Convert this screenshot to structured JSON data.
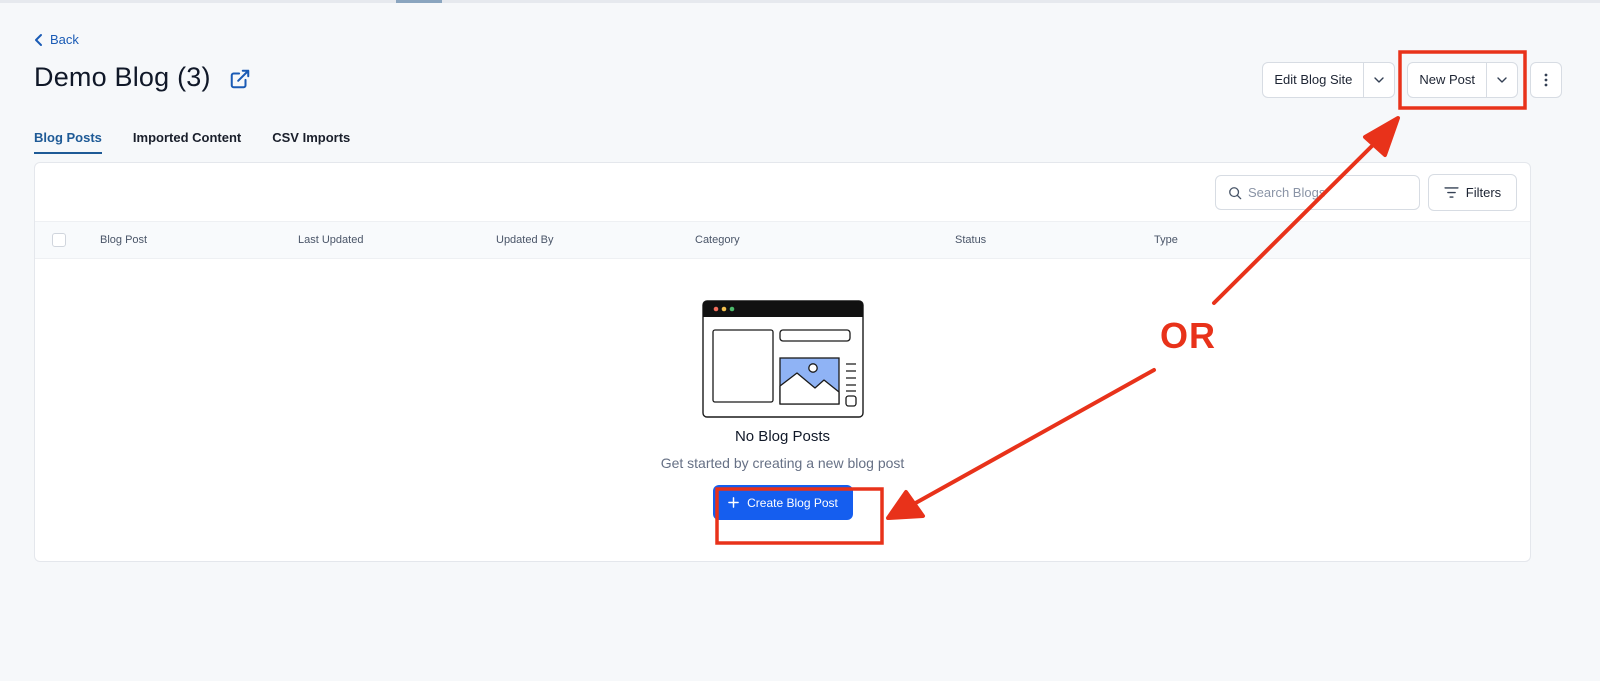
{
  "header": {
    "back_label": "Back",
    "title": "Demo Blog (3)"
  },
  "actions": {
    "edit_blog_site": "Edit Blog Site",
    "new_post": "New Post"
  },
  "tabs": [
    {
      "label": "Blog Posts",
      "active": true
    },
    {
      "label": "Imported Content",
      "active": false
    },
    {
      "label": "CSV Imports",
      "active": false
    }
  ],
  "toolbar": {
    "search_placeholder": "Search Blogs",
    "filters_label": "Filters"
  },
  "table": {
    "columns": [
      "Blog Post",
      "Last Updated",
      "Updated By",
      "Category",
      "Status",
      "Type"
    ]
  },
  "empty_state": {
    "title": "No Blog Posts",
    "subtitle": "Get started by creating a new blog post",
    "button_label": "Create Blog Post"
  },
  "annotation": {
    "label": "OR",
    "color": "#e8321a"
  },
  "colors": {
    "accent": "#1e5a96",
    "primary_button": "#155eef"
  }
}
